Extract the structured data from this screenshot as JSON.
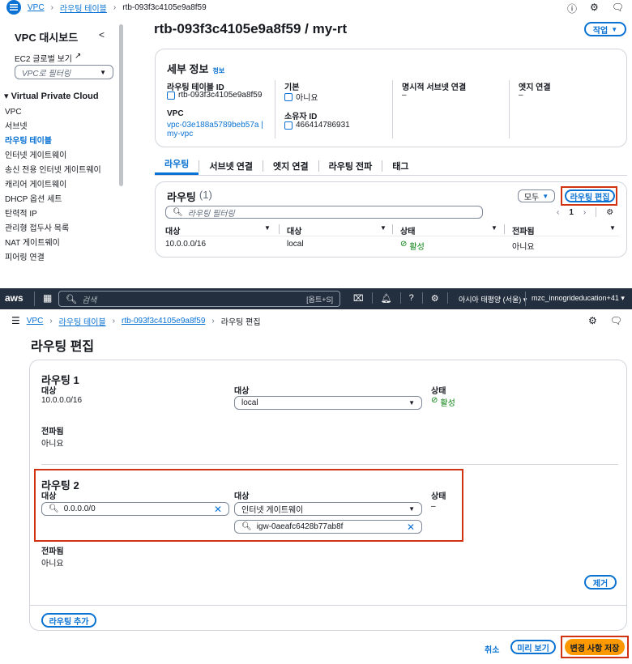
{
  "top_panel": {
    "breadcrumb": {
      "vpc": "VPC",
      "route_tables": "라우팅 테이블",
      "current": "rtb-093f3c4105e9a8f59"
    },
    "sidebar": {
      "title": "VPC 대시보드",
      "collapse": "<",
      "ec2_global": "EC2 글로벌 보기",
      "filter_placeholder": "VPC로 필터링",
      "section": "Virtual Private Cloud",
      "items": [
        "VPC",
        "서브넷",
        "라우팅 테이블",
        "인터넷 게이트웨이",
        "송신 전용 인터넷 게이트웨이",
        "캐리어 게이트웨이",
        "DHCP 옵션 세트",
        "탄력적 IP",
        "관리형 접두사 목록",
        "NAT 게이트웨이",
        "피어링 연결"
      ]
    },
    "page_title": "rtb-093f3c4105e9a8f59 / my-rt",
    "actions_button": "작업",
    "details": {
      "title": "세부 정보",
      "info": "정보",
      "route_table_id_label": "라우팅 테이블 ID",
      "route_table_id": "rtb-093f3c4105e9a8f59",
      "main_label": "기본",
      "main_value": "아니요",
      "explicit_subnet_label": "명시적 서브넷 연결",
      "explicit_subnet_value": "–",
      "edge_label": "엣지 연결",
      "edge_value": "–",
      "vpc_label": "VPC",
      "vpc_value_1": "vpc-03e188a5789beb57a |",
      "vpc_value_2": "my-vpc",
      "owner_label": "소유자 ID",
      "owner_value": "466414786931"
    },
    "tabs": [
      "라우팅",
      "서브넷 연결",
      "엣지 연결",
      "라우팅 전파",
      "태그"
    ],
    "routes": {
      "title": "라우팅",
      "count": "(1)",
      "all_button": "모두",
      "edit_button": "라우팅 편집",
      "filter_placeholder": "라우팅 필터링",
      "page": "1",
      "columns": [
        "대상",
        "대상",
        "상태",
        "전파됨"
      ],
      "row": {
        "destination": "10.0.0.0/16",
        "target": "local",
        "status": "활성",
        "propagated": "아니요"
      }
    }
  },
  "bottom_panel": {
    "topnav": {
      "logo": "aws",
      "search_placeholder": "검색",
      "shortcut": "[옵트+S]",
      "region": "아시아 태평양 (서울)",
      "account": "mzc_innogrideducation+41"
    },
    "breadcrumb": {
      "vpc": "VPC",
      "route_tables": "라우팅 테이블",
      "rtb": "rtb-093f3c4105e9a8f59",
      "current": "라우팅 편집"
    },
    "page_title": "라우팅 편집",
    "route1": {
      "title": "라우팅 1",
      "dest_label": "대상",
      "dest_value": "10.0.0.0/16",
      "target_label": "대상",
      "target_value": "local",
      "status_label": "상태",
      "status_value": "활성",
      "propagated_label": "전파됨",
      "propagated_value": "아니요"
    },
    "route2": {
      "title": "라우팅 2",
      "dest_label": "대상",
      "dest_value": "0.0.0.0/0",
      "target_label": "대상",
      "target_value": "인터넷 게이트웨이",
      "igw_value": "igw-0aeafc6428b77ab8f",
      "status_label": "상태",
      "status_value": "–",
      "propagated_label": "전파됨",
      "propagated_value": "아니요",
      "remove_button": "제거"
    },
    "add_route_button": "라우팅 추가",
    "cancel": "취소",
    "preview_button": "미리 보기",
    "save_button": "변경 사항 저장"
  },
  "colors": {
    "link": "#0972d3",
    "primary": "#ff9900",
    "highlight": "#d13212",
    "navbar": "#232f3e",
    "success": "#037f0c"
  }
}
